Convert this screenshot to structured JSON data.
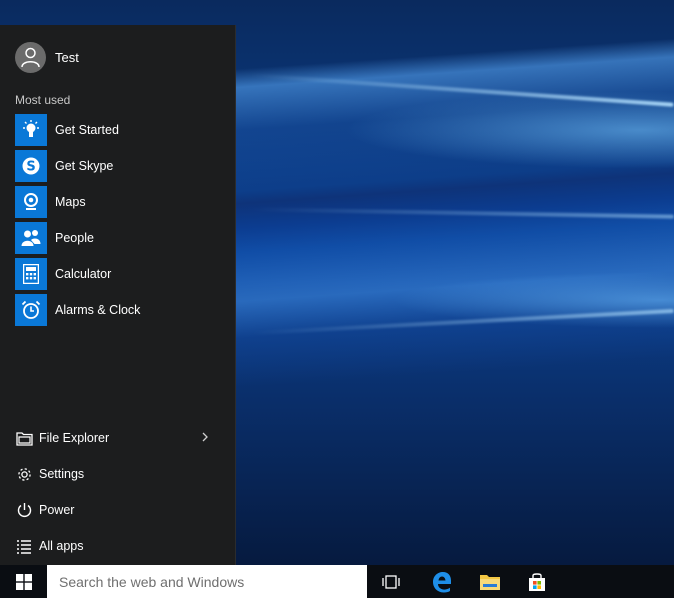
{
  "user": {
    "name": "Test"
  },
  "most_used": {
    "label": "Most used",
    "items": [
      {
        "label": "Get Started",
        "icon": "lightbulb-icon",
        "color": "#0a78d7"
      },
      {
        "label": "Get Skype",
        "icon": "skype-icon",
        "color": "#0a78d7"
      },
      {
        "label": "Maps",
        "icon": "map-pin-icon",
        "color": "#0a78d7"
      },
      {
        "label": "People",
        "icon": "people-icon",
        "color": "#0a78d7"
      },
      {
        "label": "Calculator",
        "icon": "calculator-icon",
        "color": "#0a78d7"
      },
      {
        "label": "Alarms & Clock",
        "icon": "alarm-clock-icon",
        "color": "#0a78d7"
      }
    ]
  },
  "bottom_items": [
    {
      "label": "File Explorer",
      "icon": "file-explorer-icon"
    },
    {
      "label": "Settings",
      "icon": "gear-icon"
    },
    {
      "label": "Power",
      "icon": "power-icon"
    },
    {
      "label": "All apps",
      "icon": "list-icon"
    }
  ],
  "taskbar": {
    "search_placeholder": "Search the web and Windows",
    "icons": [
      "windows-logo-icon",
      "task-view-icon",
      "edge-icon",
      "folder-icon",
      "store-icon"
    ]
  }
}
